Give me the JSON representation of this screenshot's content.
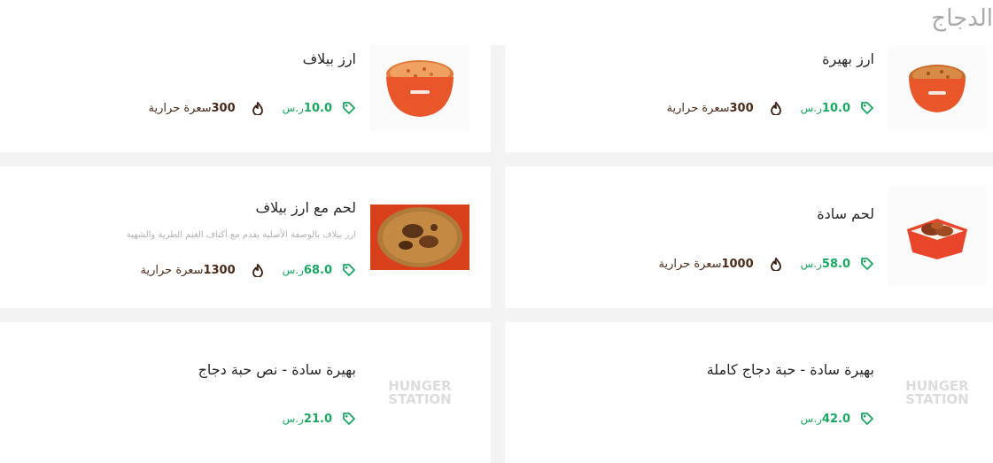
{
  "section": {
    "title": "الدجاج"
  },
  "colors": {
    "price": "#1aa860",
    "calories": "#4a2a1a",
    "title": "#a9a9a9"
  },
  "items": [
    {
      "name": "ارز بهيرة",
      "price": "10.0",
      "currency": "ر.س",
      "calories": "300",
      "calories_label": "سعرة حرارية",
      "image": "rice-bowl"
    },
    {
      "name": "ارز بيلاف",
      "price": "10.0",
      "currency": "ر.س",
      "calories": "300",
      "calories_label": "سعرة حرارية",
      "image": "rice-bowl"
    },
    {
      "name": "لحم سادة",
      "price": "58.0",
      "currency": "ر.س",
      "calories": "1000",
      "calories_label": "سعرة حرارية",
      "image": "meat-tray"
    },
    {
      "name": "لحم مع ارز بيلاف",
      "description": "ارز بيلاف بالوصفة الأصلية يقدم مع أكتاف الغنم الطرية والشهية",
      "price": "68.0",
      "currency": "ر.س",
      "calories": "1300",
      "calories_label": "سعرة حرارية",
      "image": "meat-rice-plate"
    },
    {
      "name": "بهيرة سادة - حبة دجاج كاملة",
      "price": "42.0",
      "currency": "ر.س",
      "image": "placeholder-logo",
      "logo_text": [
        "HUNGER",
        "STATION"
      ]
    },
    {
      "name": "بهيرة سادة - نص حبة دجاج",
      "price": "21.0",
      "currency": "ر.س",
      "image": "placeholder-logo",
      "logo_text": [
        "HUNGER",
        "STATION"
      ]
    }
  ]
}
